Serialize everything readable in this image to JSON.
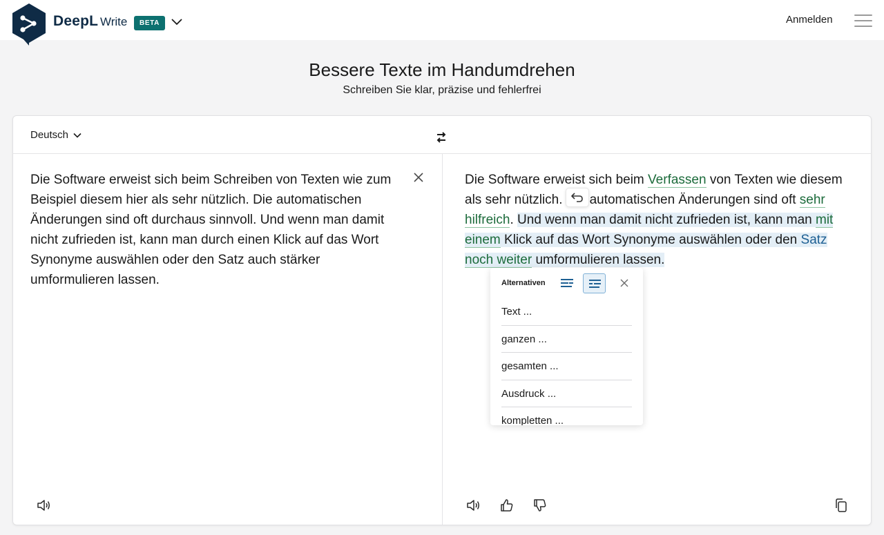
{
  "header": {
    "brand_name": "DeepL",
    "brand_product": "Write",
    "badge": "BETA",
    "signin_label": "Anmelden",
    "logo_icon": "deepl-logo-icon",
    "chevron_icon": "chevron-down-icon",
    "menu_icon": "hamburger-menu-icon",
    "colors": {
      "brand_navy": "#0f2b46",
      "badge_teal": "#0d7170"
    }
  },
  "hero": {
    "title": "Bessere Texte im Handumdrehen",
    "subtitle": "Schreiben Sie klar, präzise und fehlerfrei"
  },
  "editor": {
    "language": "Deutsch",
    "swap_icon": "swap-arrows-icon",
    "source_text": "Die Software erweist sich beim Schreiben von Texten wie zum Beispiel diesem hier als sehr nützlich. Die automatischen Änderungen sind oft durchaus sinnvoll. Und wenn man damit nicht zufrieden ist, kann man durch einen Klick auf das Wort Synonyme auswählen oder den Satz auch stärker umformulieren lassen.",
    "output": {
      "p1": "Die Software erweist sich beim ",
      "c1": "Verfassen",
      "p2": " von Texten wie diesem als sehr nützlich. Die automatischen Änderungen sind oft ",
      "c2": "sehr",
      "p3": " ",
      "c3": "hilfreich",
      "p4": ". ",
      "s1": "Und wenn man damit nicht zufrieden ist, kann man ",
      "c4": "mit",
      "s2": " ",
      "c5": "einem",
      "s3": " Klick auf das Wort Synonyme auswählen oder den ",
      "s4": "Satz",
      "s5": " ",
      "c6": "noch weiter",
      "s6": " umformulieren lassen."
    },
    "colors": {
      "change_green": "#1c6b3b",
      "selection_bg": "#e3eef6"
    }
  },
  "alternatives": {
    "heading": "Alternativen",
    "items": [
      "Text ...",
      "ganzen ...",
      "gesamten ...",
      "Ausdruck ...",
      "kompletten ..."
    ]
  },
  "icons": {
    "speaker": "speaker-icon",
    "thumbs_up": "thumbs-up-icon",
    "thumbs_down": "thumbs-down-icon",
    "copy": "copy-icon",
    "undo": "undo-icon",
    "close": "close-icon"
  }
}
